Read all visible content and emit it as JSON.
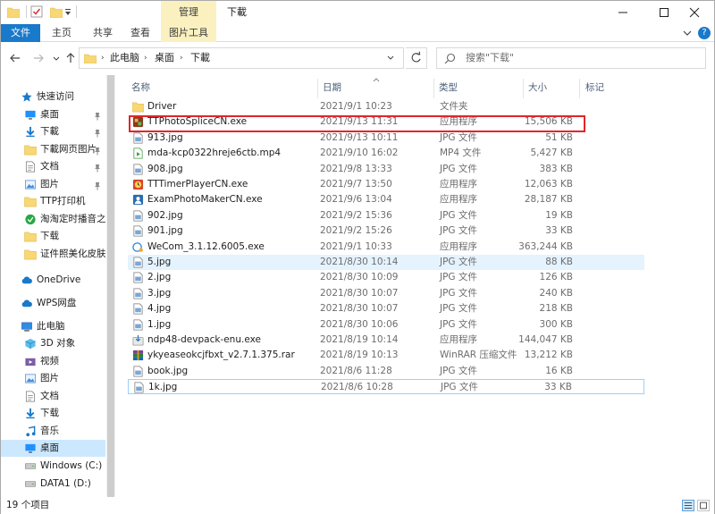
{
  "title_bar": {
    "context_tab_header": "管理",
    "window_title": "下載"
  },
  "ribbon": {
    "tabs": [
      {
        "label": "文件"
      },
      {
        "label": "主页"
      },
      {
        "label": "共享"
      },
      {
        "label": "查看"
      },
      {
        "label": "图片工具"
      }
    ],
    "help_label": "?"
  },
  "address_bar": {
    "crumbs": [
      "此电脑",
      "桌面",
      "下載"
    ],
    "separator": "›"
  },
  "search": {
    "placeholder": "搜索\"下载\""
  },
  "nav_pane": {
    "items": [
      {
        "label": "快速访问",
        "icon": "star-icon",
        "pinned": false
      },
      {
        "label": "桌面",
        "icon": "desktop-icon",
        "pinned": true
      },
      {
        "label": "下載",
        "icon": "download-icon",
        "pinned": true
      },
      {
        "label": "下載网页图片",
        "icon": "folder-icon",
        "pinned": true
      },
      {
        "label": "文档",
        "icon": "document-icon",
        "pinned": true
      },
      {
        "label": "图片",
        "icon": "picture-icon",
        "pinned": true
      },
      {
        "label": "TTP打印机",
        "icon": "folder-icon",
        "pinned": false
      },
      {
        "label": "淘淘定时播音之星",
        "icon": "app-folder-icon",
        "pinned": false
      },
      {
        "label": "下载",
        "icon": "folder-icon",
        "pinned": false
      },
      {
        "label": "证件照美化皮肤",
        "icon": "folder-icon",
        "pinned": false
      },
      {
        "label": "OneDrive",
        "icon": "cloud-icon",
        "pinned": false
      },
      {
        "label": "WPS网盘",
        "icon": "cloud-icon",
        "pinned": false
      },
      {
        "label": "此电脑",
        "icon": "computer-icon",
        "pinned": false
      },
      {
        "label": "3D 对象",
        "icon": "cube-icon",
        "pinned": false
      },
      {
        "label": "视频",
        "icon": "video-icon",
        "pinned": false
      },
      {
        "label": "图片",
        "icon": "picture-icon",
        "pinned": false
      },
      {
        "label": "文档",
        "icon": "document-icon",
        "pinned": false
      },
      {
        "label": "下载",
        "icon": "download-icon",
        "pinned": false
      },
      {
        "label": "音乐",
        "icon": "music-icon",
        "pinned": false
      },
      {
        "label": "桌面",
        "icon": "desktop-icon",
        "pinned": false
      },
      {
        "label": "Windows (C:)",
        "icon": "drive-icon",
        "pinned": false
      },
      {
        "label": "DATA1 (D:)",
        "icon": "drive-icon",
        "pinned": false
      }
    ]
  },
  "columns": {
    "name": "名称",
    "date": "日期",
    "type": "类型",
    "size": "大小",
    "tags": "标记"
  },
  "files": [
    {
      "name": "Driver",
      "date": "2021/9/1 10:23",
      "type": "文件夹",
      "size": "",
      "icon": "folder-icon"
    },
    {
      "name": "TTPhotoSpliceCN.exe",
      "date": "2021/9/13 11:31",
      "type": "应用程序",
      "size": "15,506 KB",
      "icon": "app-photo-icon"
    },
    {
      "name": "913.jpg",
      "date": "2021/9/13 10:11",
      "type": "JPG 文件",
      "size": "51 KB",
      "icon": "jpg-file-icon"
    },
    {
      "name": "mda-kcp0322hreje6ctb.mp4",
      "date": "2021/9/10 16:02",
      "type": "MP4 文件",
      "size": "5,427 KB",
      "icon": "video-file-icon"
    },
    {
      "name": "908.jpg",
      "date": "2021/9/8 13:33",
      "type": "JPG 文件",
      "size": "383 KB",
      "icon": "jpg-file-icon"
    },
    {
      "name": "TTTimerPlayerCN.exe",
      "date": "2021/9/7 13:50",
      "type": "应用程序",
      "size": "12,063 KB",
      "icon": "app-timer-icon"
    },
    {
      "name": "ExamPhotoMakerCN.exe",
      "date": "2021/9/6 13:04",
      "type": "应用程序",
      "size": "28,187 KB",
      "icon": "app-exam-icon"
    },
    {
      "name": "902.jpg",
      "date": "2021/9/2 15:36",
      "type": "JPG 文件",
      "size": "19 KB",
      "icon": "jpg-file-icon"
    },
    {
      "name": "901.jpg",
      "date": "2021/9/2 15:26",
      "type": "JPG 文件",
      "size": "33 KB",
      "icon": "jpg-file-icon"
    },
    {
      "name": "WeCom_3.1.12.6005.exe",
      "date": "2021/9/1 10:33",
      "type": "应用程序",
      "size": "363,244 KB",
      "icon": "app-wecom-icon"
    },
    {
      "name": "5.jpg",
      "date": "2021/8/30 10:14",
      "type": "JPG 文件",
      "size": "88 KB",
      "icon": "jpg-file-icon"
    },
    {
      "name": "2.jpg",
      "date": "2021/8/30 10:09",
      "type": "JPG 文件",
      "size": "126 KB",
      "icon": "jpg-file-icon"
    },
    {
      "name": "3.jpg",
      "date": "2021/8/30 10:07",
      "type": "JPG 文件",
      "size": "240 KB",
      "icon": "jpg-file-icon"
    },
    {
      "name": "4.jpg",
      "date": "2021/8/30 10:07",
      "type": "JPG 文件",
      "size": "218 KB",
      "icon": "jpg-file-icon"
    },
    {
      "name": "1.jpg",
      "date": "2021/8/30 10:06",
      "type": "JPG 文件",
      "size": "300 KB",
      "icon": "jpg-file-icon"
    },
    {
      "name": "ndp48-devpack-enu.exe",
      "date": "2021/8/19 10:14",
      "type": "应用程序",
      "size": "144,047 KB",
      "icon": "app-installer-icon"
    },
    {
      "name": "ykyeaseokcjfbxt_v2.7.1.375.rar",
      "date": "2021/8/19 10:13",
      "type": "WinRAR 压缩文件",
      "size": "13,212 KB",
      "icon": "rar-file-icon"
    },
    {
      "name": "book.jpg",
      "date": "2021/8/6 11:28",
      "type": "JPG 文件",
      "size": "16 KB",
      "icon": "jpg-file-icon"
    },
    {
      "name": "1k.jpg",
      "date": "2021/8/6 10:28",
      "type": "JPG 文件",
      "size": "33 KB",
      "icon": "jpg-file-icon"
    }
  ],
  "status_bar": {
    "item_count": "19 个项目"
  },
  "colors": {
    "accent": "#1979ca",
    "selection": "#cce8ff",
    "hover": "#e5f3ff",
    "context_tab": "#fbf1c0",
    "highlight_box": "#e0262b"
  }
}
